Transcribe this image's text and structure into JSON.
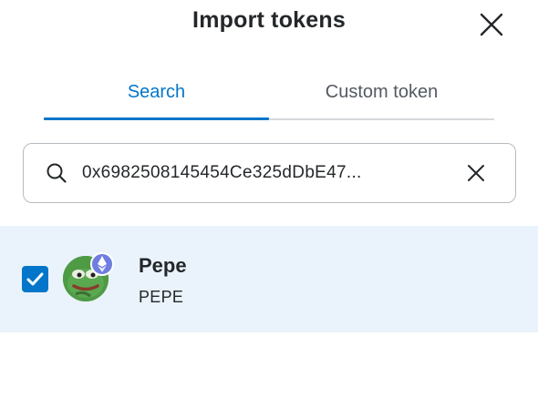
{
  "header": {
    "title": "Import tokens",
    "close_icon": "close-icon"
  },
  "tabs": [
    {
      "label": "Search",
      "active": true
    },
    {
      "label": "Custom token",
      "active": false
    }
  ],
  "search": {
    "value": "0x6982508145454Ce325dDbE47...",
    "search_icon": "search-icon",
    "clear_icon": "close-icon"
  },
  "results": [
    {
      "name": "Pepe",
      "symbol": "PEPE",
      "checked": true,
      "network_badge_icon": "ethereum-icon"
    }
  ],
  "colors": {
    "accent": "#0376c9",
    "selected_row_bg": "#eaf3fb",
    "text": "#24272a",
    "muted_text": "#535a61"
  }
}
